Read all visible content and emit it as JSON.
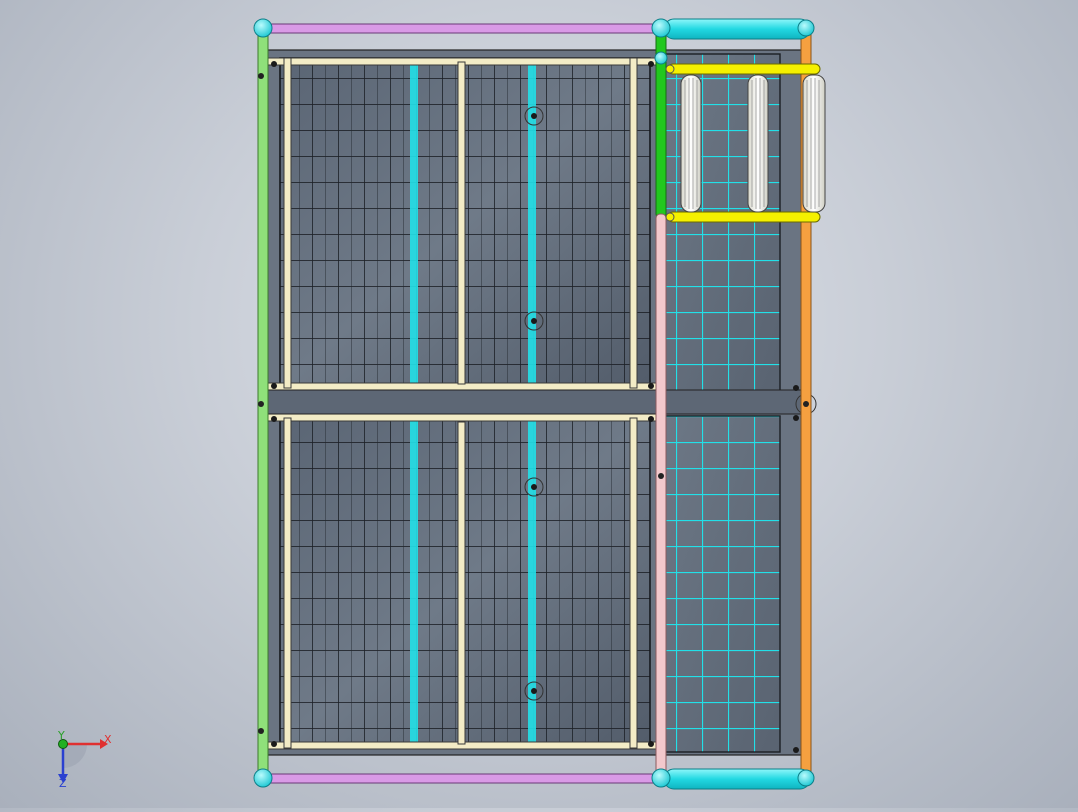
{
  "view": {
    "background_top": "#dfe3ea",
    "background_bottom": "#a9b0bc"
  },
  "colors": {
    "grating_dark": "#4a5462",
    "grating_light": "#6b7684",
    "grid_cyan": "#22e0e8",
    "grid_dark": "#1a1d22",
    "frame_cream": "#f3ecc6",
    "frame_outline": "#3a3a3a",
    "rail_magenta": "#d99ae6",
    "rail_green": "#8fe07a",
    "rail_green_bright": "#22c81e",
    "rail_pink": "#f2c8cc",
    "rail_orange": "#f5a040",
    "joint_cyan": "#39e3ea",
    "ladder_yellow": "#f5f000",
    "roller_white": "#fbfbf2"
  },
  "triad": {
    "x_label": "X",
    "y_label": "Y",
    "z_label": "Z",
    "x_color": "#e03030",
    "y_color": "#2aa02a",
    "z_color": "#2a40d0"
  }
}
